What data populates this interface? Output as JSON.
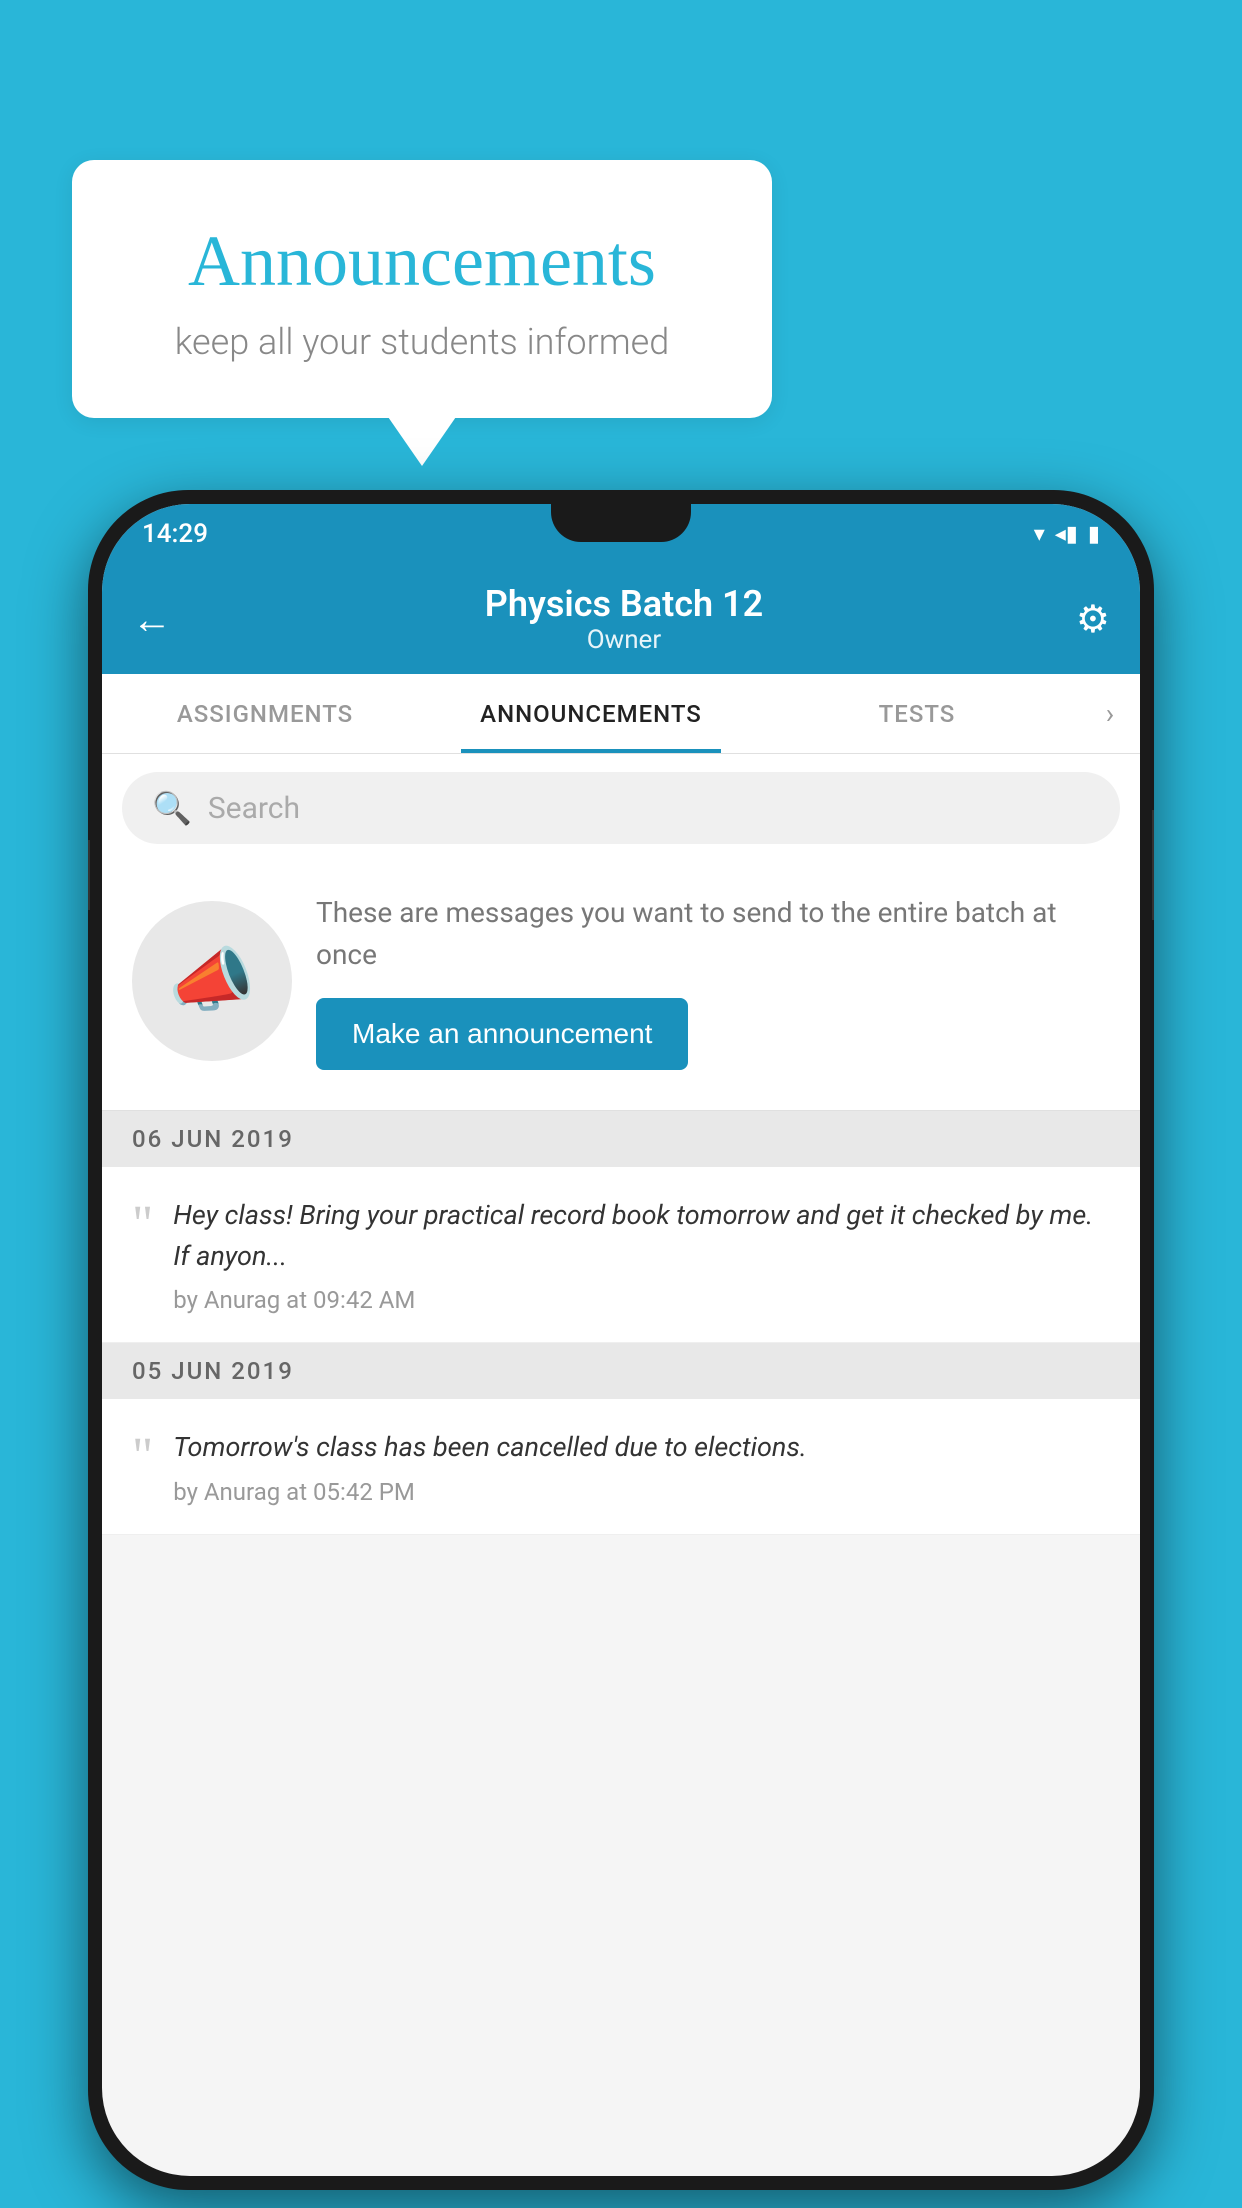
{
  "background_color": "#29b6d8",
  "speech_bubble": {
    "title": "Announcements",
    "subtitle": "keep all your students informed"
  },
  "phone": {
    "status_bar": {
      "time": "14:29",
      "icons": "▾◂▮"
    },
    "header": {
      "title": "Physics Batch 12",
      "subtitle": "Owner",
      "back_icon": "←",
      "settings_icon": "⚙"
    },
    "tabs": [
      {
        "label": "ASSIGNMENTS",
        "active": false
      },
      {
        "label": "ANNOUNCEMENTS",
        "active": true
      },
      {
        "label": "TESTS",
        "active": false
      }
    ],
    "search": {
      "placeholder": "Search"
    },
    "promo": {
      "description": "These are messages you want to send to the entire batch at once",
      "button_label": "Make an announcement"
    },
    "announcements": [
      {
        "date": "06  JUN  2019",
        "text": "Hey class! Bring your practical record book tomorrow and get it checked by me. If anyon...",
        "meta": "by Anurag at 09:42 AM"
      },
      {
        "date": "05  JUN  2019",
        "text": "Tomorrow's class has been cancelled due to elections.",
        "meta": "by Anurag at 05:42 PM"
      }
    ]
  }
}
